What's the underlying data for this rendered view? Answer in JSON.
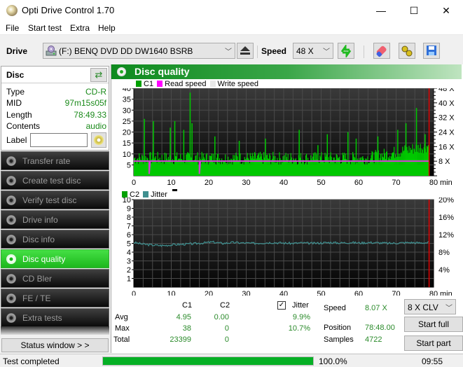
{
  "window": {
    "title": "Opti Drive Control 1.70",
    "minimize_glyph": "—",
    "maximize_glyph": "☐",
    "close_glyph": "✕"
  },
  "menu": [
    "File",
    "Start test",
    "Extra",
    "Help"
  ],
  "toolbar": {
    "drive_label": "Drive",
    "drive_value": "(F:)   BENQ DVD DD DW1640 BSRB",
    "speed_label": "Speed",
    "speed_value": "48 X",
    "icons": [
      "eject-icon",
      "refresh-icon",
      "erase-icon",
      "config-icon",
      "save-icon"
    ]
  },
  "disc": {
    "title": "Disc",
    "rows": [
      {
        "key": "Type",
        "value": "CD-R"
      },
      {
        "key": "MID",
        "value": "97m15s05f"
      },
      {
        "key": "Length",
        "value": "78:49.33"
      },
      {
        "key": "Contents",
        "value": "audio"
      }
    ],
    "label_key": "Label",
    "label_value": ""
  },
  "nav": [
    {
      "label": "Transfer rate",
      "active": false
    },
    {
      "label": "Create test disc",
      "active": false
    },
    {
      "label": "Verify test disc",
      "active": false
    },
    {
      "label": "Drive info",
      "active": false
    },
    {
      "label": "Disc info",
      "active": false
    },
    {
      "label": "Disc quality",
      "active": true
    },
    {
      "label": "CD Bler",
      "active": false
    },
    {
      "label": "FE / TE",
      "active": false
    },
    {
      "label": "Extra tests",
      "active": false
    }
  ],
  "status_window_label": "Status window > >",
  "panel": {
    "title": "Disc quality"
  },
  "chart_data": [
    {
      "type": "bar",
      "title": "C1 / Read speed",
      "legend": [
        {
          "name": "C1",
          "color": "#00a000"
        },
        {
          "name": "Read speed",
          "color": "#ff00ff"
        },
        {
          "name": "Write speed",
          "color": "#e8e8e8"
        }
      ],
      "xlabel": "min",
      "x_ticks": [
        0,
        10,
        20,
        30,
        40,
        50,
        60,
        70,
        80
      ],
      "xlim": [
        0,
        80
      ],
      "y_ticks": [
        5,
        10,
        15,
        20,
        25,
        30,
        35,
        40
      ],
      "ylim": [
        0,
        40
      ],
      "y2_ticks": [
        "8 X",
        "16 X",
        "24 X",
        "32 X",
        "40 X",
        "48 X"
      ],
      "y2lim": [
        0,
        48
      ],
      "grid": true,
      "end_marker_min": 78.8,
      "c1_baseline": 5,
      "c1_spikes": [
        {
          "x": 2.7,
          "v": 26
        },
        {
          "x": 5.1,
          "v": 25
        },
        {
          "x": 10.8,
          "v": 25
        },
        {
          "x": 14.9,
          "v": 38
        },
        {
          "x": 15.4,
          "v": 24
        },
        {
          "x": 13.2,
          "v": 21
        },
        {
          "x": 9.6,
          "v": 22
        },
        {
          "x": 21.5,
          "v": 18
        },
        {
          "x": 28.0,
          "v": 16
        },
        {
          "x": 35.0,
          "v": 17
        },
        {
          "x": 44.0,
          "v": 21
        },
        {
          "x": 49.0,
          "v": 14
        },
        {
          "x": 51.5,
          "v": 19
        },
        {
          "x": 57.0,
          "v": 20
        },
        {
          "x": 59.2,
          "v": 17
        },
        {
          "x": 65.0,
          "v": 18
        },
        {
          "x": 70.3,
          "v": 21
        },
        {
          "x": 72.5,
          "v": 24
        },
        {
          "x": 75.3,
          "v": 31
        },
        {
          "x": 77.6,
          "v": 19
        }
      ],
      "read_speed_x": 8.07,
      "read_speed_dips": [
        {
          "x": 4.1,
          "v": 1
        },
        {
          "x": 17.5,
          "v": 1
        }
      ]
    },
    {
      "type": "line",
      "title": "C2 / Jitter",
      "legend": [
        {
          "name": "C2",
          "color": "#00a000"
        },
        {
          "name": "Jitter",
          "color": "#3f8f8f"
        }
      ],
      "xlabel": "min",
      "x_ticks": [
        0,
        10,
        20,
        30,
        40,
        50,
        60,
        70,
        80
      ],
      "xlim": [
        0,
        80
      ],
      "y_ticks": [
        1,
        2,
        3,
        4,
        5,
        6,
        7,
        8,
        9,
        10
      ],
      "ylim": [
        0,
        10
      ],
      "y2_ticks": [
        "4%",
        "8%",
        "12%",
        "16%",
        "20%"
      ],
      "y2lim": [
        0,
        20
      ],
      "grid": true,
      "end_marker_min": 78.8,
      "jitter_pct": [
        10.2,
        9.8,
        9.6,
        9.5,
        9.7,
        9.8,
        9.9,
        10.1,
        10.3,
        10.0,
        10.2,
        10.1,
        10.0,
        10.1,
        10.2,
        10.1,
        10.0,
        10.1,
        10.0,
        10.1,
        10.2,
        10.1,
        10.2,
        10.1,
        10.2,
        10.1,
        10.0,
        10.1,
        10.2,
        10.1,
        10.2
      ]
    }
  ],
  "stats": {
    "col_c1": "C1",
    "col_c2": "C2",
    "avg_label": "Avg",
    "max_label": "Max",
    "total_label": "Total",
    "c1_avg": "4.95",
    "c2_avg": "0.00",
    "c1_max": "38",
    "c2_max": "0",
    "c1_total": "23399",
    "c2_total": "0",
    "jitter_label": "Jitter",
    "jitter_checked": true,
    "jitter_avg": "9.9%",
    "jitter_max": "10.7%",
    "speed_label": "Speed",
    "speed_value": "8.07 X",
    "position_label": "Position",
    "position_value": "78:48.00",
    "samples_label": "Samples",
    "samples_value": "4722",
    "clv_value": "8 X CLV",
    "start_full": "Start full",
    "start_part": "Start part"
  },
  "statusbar": {
    "text": "Test completed",
    "progress": 1.0,
    "progress_text": "100.0%",
    "time": "09:55"
  }
}
